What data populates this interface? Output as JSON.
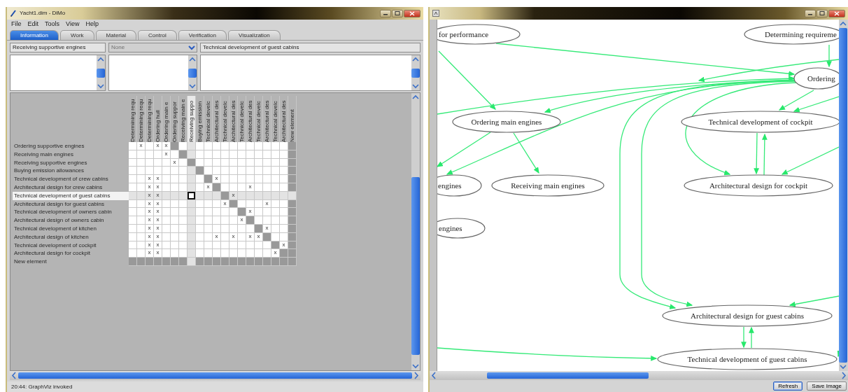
{
  "left_window": {
    "title": "Yacht1.dim - DiMo",
    "menu": [
      "File",
      "Edit",
      "Tools",
      "View",
      "Help"
    ],
    "tabs": [
      {
        "label": "Information",
        "selected": true
      },
      {
        "label": "Work",
        "selected": false
      },
      {
        "label": "Material",
        "selected": false
      },
      {
        "label": "Control",
        "selected": false
      },
      {
        "label": "Verification",
        "selected": false
      },
      {
        "label": "Visualization",
        "selected": false
      }
    ],
    "source_field": {
      "value": "Receiving supportive engines"
    },
    "type_combo": {
      "value": "None",
      "disabled": true
    },
    "target_field": {
      "value": "Technical development of guest cabins"
    },
    "matrix": {
      "columns": [
        {
          "label": "Determining requ",
          "selected": false
        },
        {
          "label": "Determining requ",
          "selected": false
        },
        {
          "label": "Determining requ",
          "selected": false
        },
        {
          "label": "Ordering hull",
          "selected": false
        },
        {
          "label": "Ordering main e",
          "selected": false
        },
        {
          "label": "Ordering suppor",
          "selected": false
        },
        {
          "label": "Receiving main e",
          "selected": false
        },
        {
          "label": "Receiving suppo",
          "selected": true
        },
        {
          "label": "Buying emission",
          "selected": false
        },
        {
          "label": "Technical develc",
          "selected": false
        },
        {
          "label": "Architectural des",
          "selected": false
        },
        {
          "label": "Technical develc",
          "selected": false
        },
        {
          "label": "Architectural des",
          "selected": false
        },
        {
          "label": "Technical develc",
          "selected": false
        },
        {
          "label": "Architectural des",
          "selected": false
        },
        {
          "label": "Technical develc",
          "selected": false
        },
        {
          "label": "Architectural des",
          "selected": false
        },
        {
          "label": "Technical develc",
          "selected": false
        },
        {
          "label": "Architectural des",
          "selected": false
        },
        {
          "label": "New element",
          "selected": false
        }
      ],
      "rows": [
        {
          "label": "Ordering supportive engines",
          "selected": false,
          "cells": [
            {
              "kind": "blank"
            },
            {
              "kind": "mark",
              "text": "x"
            },
            {
              "kind": "blank"
            },
            {
              "kind": "mark",
              "text": "x"
            },
            {
              "kind": "mark",
              "text": "x"
            },
            {
              "kind": "shaded"
            },
            {
              "kind": "blank"
            },
            {
              "kind": "blank"
            },
            {
              "kind": "blank"
            },
            {
              "kind": "blank"
            },
            {
              "kind": "blank"
            },
            {
              "kind": "blank"
            },
            {
              "kind": "blank"
            },
            {
              "kind": "blank"
            },
            {
              "kind": "blank"
            },
            {
              "kind": "blank"
            },
            {
              "kind": "blank"
            },
            {
              "kind": "blank"
            },
            {
              "kind": "blank"
            },
            {
              "kind": "shaded"
            }
          ]
        },
        {
          "label": "Receiving main engines",
          "selected": false,
          "cells": [
            {
              "kind": "blank"
            },
            {
              "kind": "blank"
            },
            {
              "kind": "blank"
            },
            {
              "kind": "blank"
            },
            {
              "kind": "mark",
              "text": "x"
            },
            {
              "kind": "blank"
            },
            {
              "kind": "shaded"
            },
            {
              "kind": "blank"
            },
            {
              "kind": "blank"
            },
            {
              "kind": "blank"
            },
            {
              "kind": "blank"
            },
            {
              "kind": "blank"
            },
            {
              "kind": "blank"
            },
            {
              "kind": "blank"
            },
            {
              "kind": "blank"
            },
            {
              "kind": "blank"
            },
            {
              "kind": "blank"
            },
            {
              "kind": "blank"
            },
            {
              "kind": "blank"
            },
            {
              "kind": "shaded"
            }
          ]
        },
        {
          "label": "Receiving supportive engines",
          "selected": false,
          "cells": [
            {
              "kind": "blank"
            },
            {
              "kind": "blank"
            },
            {
              "kind": "blank"
            },
            {
              "kind": "blank"
            },
            {
              "kind": "blank"
            },
            {
              "kind": "mark",
              "text": "x"
            },
            {
              "kind": "blank"
            },
            {
              "kind": "shaded"
            },
            {
              "kind": "blank"
            },
            {
              "kind": "blank"
            },
            {
              "kind": "blank"
            },
            {
              "kind": "blank"
            },
            {
              "kind": "blank"
            },
            {
              "kind": "blank"
            },
            {
              "kind": "blank"
            },
            {
              "kind": "blank"
            },
            {
              "kind": "blank"
            },
            {
              "kind": "blank"
            },
            {
              "kind": "blank"
            },
            {
              "kind": "shaded"
            }
          ]
        },
        {
          "label": "Buying emission allowances",
          "selected": false,
          "cells": [
            {
              "kind": "blank"
            },
            {
              "kind": "blank"
            },
            {
              "kind": "blank"
            },
            {
              "kind": "blank"
            },
            {
              "kind": "blank"
            },
            {
              "kind": "blank"
            },
            {
              "kind": "blank"
            },
            {
              "kind": "blank"
            },
            {
              "kind": "shaded"
            },
            {
              "kind": "blank"
            },
            {
              "kind": "blank"
            },
            {
              "kind": "blank"
            },
            {
              "kind": "blank"
            },
            {
              "kind": "blank"
            },
            {
              "kind": "blank"
            },
            {
              "kind": "blank"
            },
            {
              "kind": "blank"
            },
            {
              "kind": "blank"
            },
            {
              "kind": "blank"
            },
            {
              "kind": "shaded"
            }
          ]
        },
        {
          "label": "Technical development of crew cabins",
          "selected": false,
          "cells": [
            {
              "kind": "blank"
            },
            {
              "kind": "blank"
            },
            {
              "kind": "mark",
              "text": "x"
            },
            {
              "kind": "mark",
              "text": "x"
            },
            {
              "kind": "blank"
            },
            {
              "kind": "blank"
            },
            {
              "kind": "blank"
            },
            {
              "kind": "blank"
            },
            {
              "kind": "blank"
            },
            {
              "kind": "shaded"
            },
            {
              "kind": "mark",
              "text": "x"
            },
            {
              "kind": "blank"
            },
            {
              "kind": "blank"
            },
            {
              "kind": "blank"
            },
            {
              "kind": "blank"
            },
            {
              "kind": "blank"
            },
            {
              "kind": "blank"
            },
            {
              "kind": "blank"
            },
            {
              "kind": "blank"
            },
            {
              "kind": "shaded"
            }
          ]
        },
        {
          "label": "Architectural design for crew cabins",
          "selected": false,
          "cells": [
            {
              "kind": "blank"
            },
            {
              "kind": "blank"
            },
            {
              "kind": "mark",
              "text": "x"
            },
            {
              "kind": "mark",
              "text": "x"
            },
            {
              "kind": "blank"
            },
            {
              "kind": "blank"
            },
            {
              "kind": "blank"
            },
            {
              "kind": "blank"
            },
            {
              "kind": "blank"
            },
            {
              "kind": "mark",
              "text": "x"
            },
            {
              "kind": "shaded"
            },
            {
              "kind": "blank"
            },
            {
              "kind": "blank"
            },
            {
              "kind": "blank"
            },
            {
              "kind": "mark",
              "text": "x"
            },
            {
              "kind": "blank"
            },
            {
              "kind": "blank"
            },
            {
              "kind": "blank"
            },
            {
              "kind": "blank"
            },
            {
              "kind": "shaded"
            }
          ]
        },
        {
          "label": "Technical development of guest cabins",
          "selected": true,
          "cells": [
            {
              "kind": "blank"
            },
            {
              "kind": "blank"
            },
            {
              "kind": "mark",
              "text": "x"
            },
            {
              "kind": "mark",
              "text": "x"
            },
            {
              "kind": "blank"
            },
            {
              "kind": "blank"
            },
            {
              "kind": "blank"
            },
            {
              "kind": "blank"
            },
            {
              "kind": "blank"
            },
            {
              "kind": "blank"
            },
            {
              "kind": "blank"
            },
            {
              "kind": "shaded"
            },
            {
              "kind": "mark",
              "text": "x"
            },
            {
              "kind": "blank"
            },
            {
              "kind": "blank"
            },
            {
              "kind": "blank"
            },
            {
              "kind": "blank"
            },
            {
              "kind": "blank"
            },
            {
              "kind": "blank"
            },
            {
              "kind": "blank"
            }
          ]
        },
        {
          "label": "Architectural design for guest cabins",
          "selected": false,
          "cells": [
            {
              "kind": "blank"
            },
            {
              "kind": "blank"
            },
            {
              "kind": "mark",
              "text": "x"
            },
            {
              "kind": "mark",
              "text": "x"
            },
            {
              "kind": "blank"
            },
            {
              "kind": "blank"
            },
            {
              "kind": "blank"
            },
            {
              "kind": "blank"
            },
            {
              "kind": "blank"
            },
            {
              "kind": "blank"
            },
            {
              "kind": "blank"
            },
            {
              "kind": "mark",
              "text": "x"
            },
            {
              "kind": "shaded"
            },
            {
              "kind": "blank"
            },
            {
              "kind": "blank"
            },
            {
              "kind": "blank"
            },
            {
              "kind": "mark",
              "text": "x"
            },
            {
              "kind": "blank"
            },
            {
              "kind": "blank"
            },
            {
              "kind": "shaded"
            }
          ]
        },
        {
          "label": "Technical development of owners cabin",
          "selected": false,
          "cells": [
            {
              "kind": "blank"
            },
            {
              "kind": "blank"
            },
            {
              "kind": "mark",
              "text": "x"
            },
            {
              "kind": "mark",
              "text": "x"
            },
            {
              "kind": "blank"
            },
            {
              "kind": "blank"
            },
            {
              "kind": "blank"
            },
            {
              "kind": "blank"
            },
            {
              "kind": "blank"
            },
            {
              "kind": "blank"
            },
            {
              "kind": "blank"
            },
            {
              "kind": "blank"
            },
            {
              "kind": "blank"
            },
            {
              "kind": "shaded"
            },
            {
              "kind": "mark",
              "text": "x"
            },
            {
              "kind": "blank"
            },
            {
              "kind": "blank"
            },
            {
              "kind": "blank"
            },
            {
              "kind": "blank"
            },
            {
              "kind": "shaded"
            }
          ]
        },
        {
          "label": "Architectural design of owners cabin",
          "selected": false,
          "cells": [
            {
              "kind": "blank"
            },
            {
              "kind": "blank"
            },
            {
              "kind": "mark",
              "text": "x"
            },
            {
              "kind": "mark",
              "text": "x"
            },
            {
              "kind": "blank"
            },
            {
              "kind": "blank"
            },
            {
              "kind": "blank"
            },
            {
              "kind": "blank"
            },
            {
              "kind": "blank"
            },
            {
              "kind": "blank"
            },
            {
              "kind": "blank"
            },
            {
              "kind": "blank"
            },
            {
              "kind": "blank"
            },
            {
              "kind": "mark",
              "text": "x"
            },
            {
              "kind": "shaded"
            },
            {
              "kind": "blank"
            },
            {
              "kind": "blank"
            },
            {
              "kind": "blank"
            },
            {
              "kind": "blank"
            },
            {
              "kind": "shaded"
            }
          ]
        },
        {
          "label": "Technical development of kitchen",
          "selected": false,
          "cells": [
            {
              "kind": "blank"
            },
            {
              "kind": "blank"
            },
            {
              "kind": "mark",
              "text": "x"
            },
            {
              "kind": "mark",
              "text": "x"
            },
            {
              "kind": "blank"
            },
            {
              "kind": "blank"
            },
            {
              "kind": "blank"
            },
            {
              "kind": "blank"
            },
            {
              "kind": "blank"
            },
            {
              "kind": "blank"
            },
            {
              "kind": "blank"
            },
            {
              "kind": "blank"
            },
            {
              "kind": "blank"
            },
            {
              "kind": "blank"
            },
            {
              "kind": "blank"
            },
            {
              "kind": "shaded"
            },
            {
              "kind": "mark",
              "text": "x"
            },
            {
              "kind": "blank"
            },
            {
              "kind": "blank"
            },
            {
              "kind": "shaded"
            }
          ]
        },
        {
          "label": "Architectural design of kitchen",
          "selected": false,
          "cells": [
            {
              "kind": "blank"
            },
            {
              "kind": "blank"
            },
            {
              "kind": "mark",
              "text": "x"
            },
            {
              "kind": "mark",
              "text": "x"
            },
            {
              "kind": "blank"
            },
            {
              "kind": "blank"
            },
            {
              "kind": "blank"
            },
            {
              "kind": "blank"
            },
            {
              "kind": "blank"
            },
            {
              "kind": "blank"
            },
            {
              "kind": "mark",
              "text": "x"
            },
            {
              "kind": "blank"
            },
            {
              "kind": "mark",
              "text": "x"
            },
            {
              "kind": "blank"
            },
            {
              "kind": "mark",
              "text": "x"
            },
            {
              "kind": "mark",
              "text": "x"
            },
            {
              "kind": "shaded"
            },
            {
              "kind": "blank"
            },
            {
              "kind": "blank"
            },
            {
              "kind": "shaded"
            }
          ]
        },
        {
          "label": "Technical development of cockpit",
          "selected": false,
          "cells": [
            {
              "kind": "blank"
            },
            {
              "kind": "blank"
            },
            {
              "kind": "mark",
              "text": "x"
            },
            {
              "kind": "mark",
              "text": "x"
            },
            {
              "kind": "blank"
            },
            {
              "kind": "blank"
            },
            {
              "kind": "blank"
            },
            {
              "kind": "blank"
            },
            {
              "kind": "blank"
            },
            {
              "kind": "blank"
            },
            {
              "kind": "blank"
            },
            {
              "kind": "blank"
            },
            {
              "kind": "blank"
            },
            {
              "kind": "blank"
            },
            {
              "kind": "blank"
            },
            {
              "kind": "blank"
            },
            {
              "kind": "blank"
            },
            {
              "kind": "shaded"
            },
            {
              "kind": "mark",
              "text": "x"
            },
            {
              "kind": "shaded"
            }
          ]
        },
        {
          "label": "Architectural design for cockpit",
          "selected": false,
          "cells": [
            {
              "kind": "blank"
            },
            {
              "kind": "blank"
            },
            {
              "kind": "mark",
              "text": "x"
            },
            {
              "kind": "mark",
              "text": "x"
            },
            {
              "kind": "blank"
            },
            {
              "kind": "blank"
            },
            {
              "kind": "blank"
            },
            {
              "kind": "blank"
            },
            {
              "kind": "blank"
            },
            {
              "kind": "blank"
            },
            {
              "kind": "blank"
            },
            {
              "kind": "blank"
            },
            {
              "kind": "blank"
            },
            {
              "kind": "blank"
            },
            {
              "kind": "blank"
            },
            {
              "kind": "blank"
            },
            {
              "kind": "blank"
            },
            {
              "kind": "mark",
              "text": "x"
            },
            {
              "kind": "shaded"
            },
            {
              "kind": "shaded"
            }
          ]
        },
        {
          "label": "New element",
          "selected": false,
          "cells": [
            {
              "kind": "shaded"
            },
            {
              "kind": "shaded"
            },
            {
              "kind": "shaded"
            },
            {
              "kind": "shaded"
            },
            {
              "kind": "shaded"
            },
            {
              "kind": "shaded"
            },
            {
              "kind": "shaded"
            },
            {
              "kind": "blank"
            },
            {
              "kind": "shaded"
            },
            {
              "kind": "shaded"
            },
            {
              "kind": "shaded"
            },
            {
              "kind": "shaded"
            },
            {
              "kind": "shaded"
            },
            {
              "kind": "shaded"
            },
            {
              "kind": "shaded"
            },
            {
              "kind": "shaded"
            },
            {
              "kind": "shaded"
            },
            {
              "kind": "shaded"
            },
            {
              "kind": "shaded"
            },
            {
              "kind": "shaded"
            }
          ]
        }
      ]
    },
    "status_bar": "20:44: GraphViz invoked"
  },
  "graph_window": {
    "nodes": [
      {
        "label": "for performance"
      },
      {
        "label": "Determining requireme"
      },
      {
        "label": "Ordering"
      },
      {
        "label": "Ordering main engines"
      },
      {
        "label": "Technical development of cockpit"
      },
      {
        "label": "engines"
      },
      {
        "label": "Receiving main engines"
      },
      {
        "label": "Architectural design for cockpit"
      },
      {
        "label": "engines"
      },
      {
        "label": "Architectural design for guest cabins"
      },
      {
        "label": "Technical development of guest cabins"
      }
    ],
    "buttons": [
      {
        "label": "Refresh",
        "focused": true
      },
      {
        "label": "Save Image",
        "focused": false
      }
    ]
  }
}
